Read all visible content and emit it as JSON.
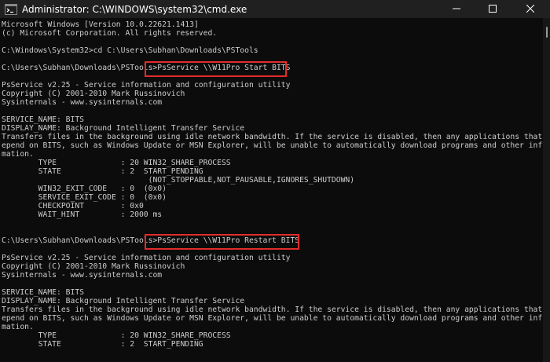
{
  "window": {
    "title": "Administrator: C:\\WINDOWS\\system32\\cmd.exe",
    "icon": "cmd-icon",
    "controls": [
      "minimize-icon",
      "maximize-icon",
      "close-icon"
    ]
  },
  "console": {
    "lines": [
      "Microsoft Windows [Version 10.0.22621.1413]",
      "(c) Microsoft Corporation. All rights reserved.",
      "",
      "C:\\Windows\\System32>cd C:\\Users\\Subhan\\Downloads\\PSTools",
      "",
      "C:\\Users\\Subhan\\Downloads\\PSTools>PsService \\\\W11Pro Start BITS",
      "",
      "PsService v2.25 - Service information and configuration utility",
      "Copyright (C) 2001-2010 Mark Russinovich",
      "Sysinternals - www.sysinternals.com",
      "",
      "SERVICE_NAME: BITS",
      "DISPLAY_NAME: Background Intelligent Transfer Service",
      "Transfers files in the background using idle network bandwidth. If the service is disabled, then any applications that d",
      "epend on BITS, such as Windows Update or MSN Explorer, will be unable to automatically download programs and other infor",
      "mation.",
      "        TYPE              : 20 WIN32_SHARE_PROCESS",
      "        STATE             : 2  START_PENDING",
      "                                (NOT_STOPPABLE,NOT_PAUSABLE,IGNORES_SHUTDOWN)",
      "        WIN32_EXIT_CODE   : 0  (0x0)",
      "        SERVICE_EXIT_CODE : 0  (0x0)",
      "        CHECKPOINT        : 0x0",
      "        WAIT_HINT         : 2000 ms",
      "",
      "",
      "C:\\Users\\Subhan\\Downloads\\PSTools>PsService \\\\W11Pro Restart BITS",
      "",
      "PsService v2.25 - Service information and configuration utility",
      "Copyright (C) 2001-2010 Mark Russinovich",
      "Sysinternals - www.sysinternals.com",
      "",
      "SERVICE_NAME: BITS",
      "DISPLAY_NAME: Background Intelligent Transfer Service",
      "Transfers files in the background using idle network bandwidth. If the service is disabled, then any applications that d",
      "epend on BITS, such as Windows Update or MSN Explorer, will be unable to automatically download programs and other infor",
      "mation.",
      "        TYPE              : 20 WIN32_SHARE_PROCESS",
      "        STATE             : 2  START_PENDING"
    ]
  },
  "highlight_color": "#e02c2c",
  "colors": {
    "console_bg": "#0c0c0c",
    "console_text": "#cccccc",
    "titlebar_bg": "#202020"
  }
}
